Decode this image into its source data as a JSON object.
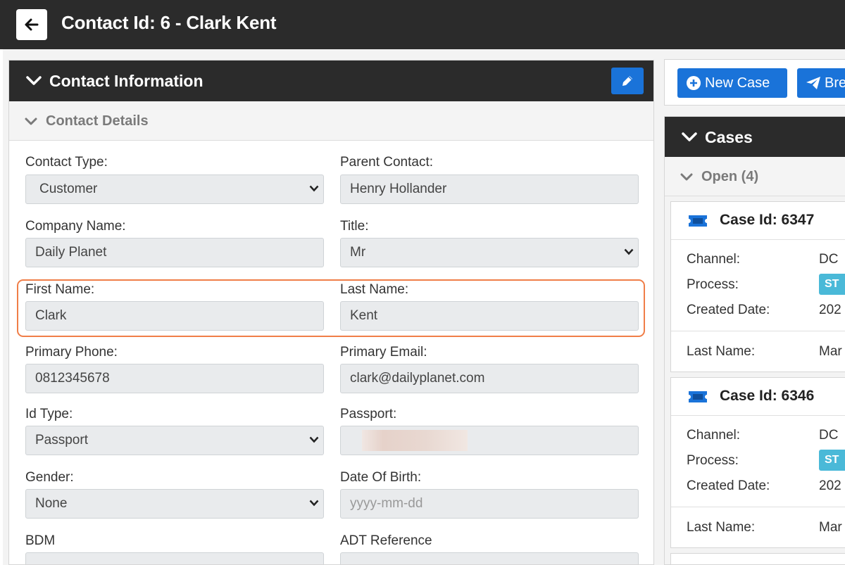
{
  "header": {
    "title": "Contact Id: 6 - Clark Kent"
  },
  "contact_panel": {
    "title": "Contact Information",
    "section_title": "Contact Details",
    "fields": {
      "contact_type": {
        "label": "Contact Type:",
        "value": "Customer"
      },
      "parent_contact": {
        "label": "Parent Contact:",
        "value": "Henry Hollander"
      },
      "company_name": {
        "label": "Company Name:",
        "value": "Daily Planet"
      },
      "title": {
        "label": "Title:",
        "value": "Mr"
      },
      "first_name": {
        "label": "First Name:",
        "value": "Clark"
      },
      "last_name": {
        "label": "Last Name:",
        "value": "Kent"
      },
      "primary_phone": {
        "label": "Primary Phone:",
        "value": "0812345678"
      },
      "primary_email": {
        "label": "Primary Email:",
        "value": "clark@dailyplanet.com"
      },
      "id_type": {
        "label": "Id Type:",
        "value": "Passport"
      },
      "passport": {
        "label": "Passport:",
        "value": ""
      },
      "gender": {
        "label": "Gender:",
        "value": "None"
      },
      "date_of_birth": {
        "label": "Date Of Birth:",
        "placeholder": "yyyy-mm-dd"
      },
      "bdm": {
        "label": "BDM",
        "value": ""
      },
      "adt_reference": {
        "label": "ADT Reference",
        "value": ""
      }
    }
  },
  "toolbar": {
    "new_case": "New Case",
    "second_button": "Bre"
  },
  "cases": {
    "title": "Cases",
    "open_label": "Open (4)",
    "items": [
      {
        "title": "Case Id: 6347",
        "channel_label": "Channel:",
        "channel": "DC",
        "process_label": "Process:",
        "process_badge": "ST",
        "created_label": "Created Date:",
        "created": "202",
        "last_name_label": "Last Name:",
        "last_name": "Mar"
      },
      {
        "title": "Case Id: 6346",
        "channel_label": "Channel:",
        "channel": "DC",
        "process_label": "Process:",
        "process_badge": "ST",
        "created_label": "Created Date:",
        "created": "202",
        "last_name_label": "Last Name:",
        "last_name": "Mar"
      }
    ]
  },
  "colors": {
    "header": "#2b2b2b",
    "primary": "#1a73d9",
    "highlight": "#f07e48",
    "badge": "#4ab9d8"
  }
}
